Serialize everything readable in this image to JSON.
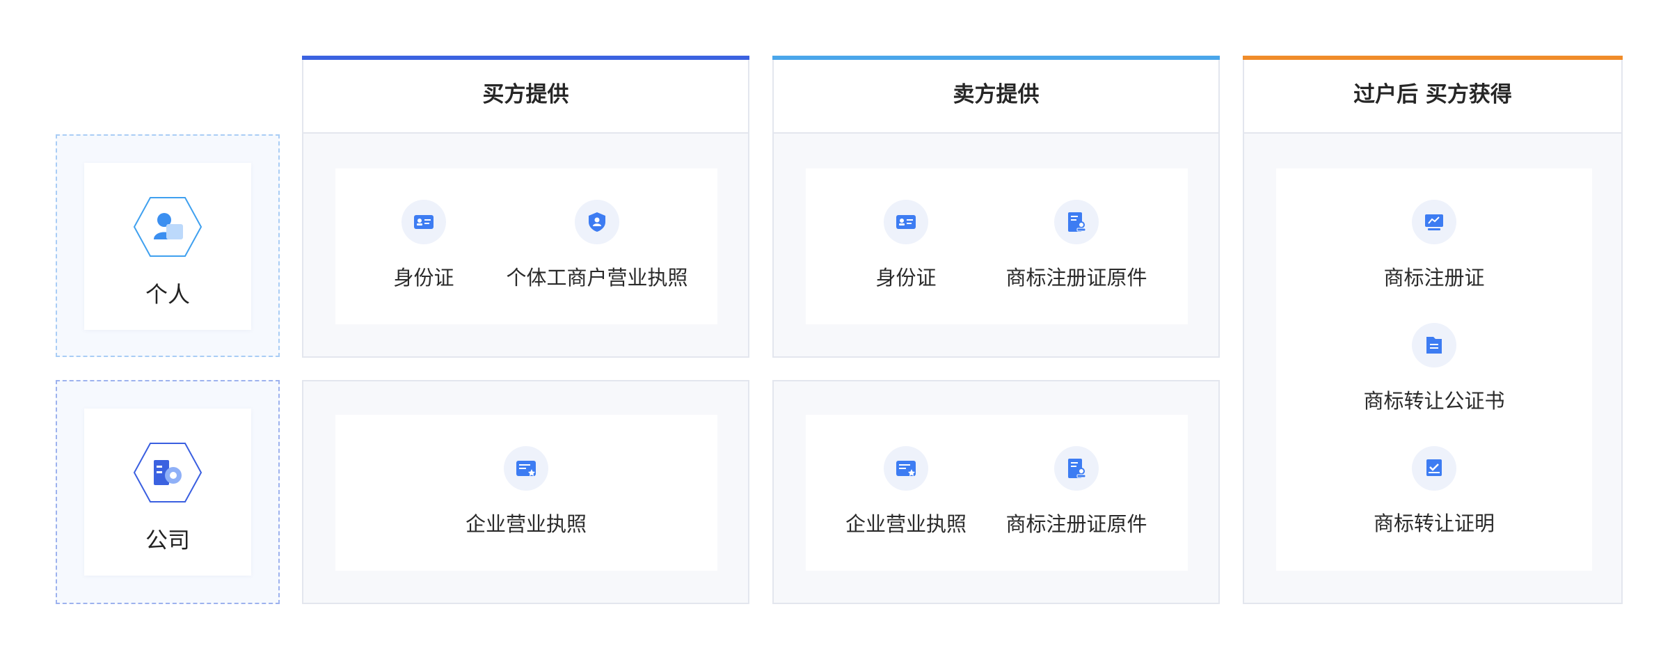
{
  "rows": [
    {
      "id": "personal",
      "label": "个人",
      "icon": "person-icon"
    },
    {
      "id": "company",
      "label": "公司",
      "icon": "company-icon"
    }
  ],
  "columns": [
    {
      "id": "buyer",
      "title": "买方提供",
      "accent": "#3b62e0"
    },
    {
      "id": "seller",
      "title": "卖方提供",
      "accent": "#4aa6ea"
    },
    {
      "id": "after",
      "title": "过户后 买方获得",
      "accent": "#f08c2a"
    }
  ],
  "cells": {
    "buyer_personal": [
      {
        "label": "身份证",
        "icon": "id-card-icon"
      },
      {
        "label": "个体工商户营业执照",
        "icon": "shield-badge-icon"
      }
    ],
    "seller_personal": [
      {
        "label": "身份证",
        "icon": "id-card-icon"
      },
      {
        "label": "商标注册证原件",
        "icon": "document-stamp-icon"
      }
    ],
    "buyer_company": [
      {
        "label": "企业营业执照",
        "icon": "license-star-icon"
      }
    ],
    "seller_company": [
      {
        "label": "企业营业执照",
        "icon": "license-star-icon"
      },
      {
        "label": "商标注册证原件",
        "icon": "document-stamp-icon"
      }
    ],
    "after": [
      {
        "label": "商标注册证",
        "icon": "certificate-chart-icon"
      },
      {
        "label": "商标转让公证书",
        "icon": "folder-doc-icon"
      },
      {
        "label": "商标转让证明",
        "icon": "checked-doc-icon"
      }
    ]
  },
  "colors": {
    "primary": "#3d7cf2",
    "icon_bg": "#eef2fb",
    "border": "#e3e6ee",
    "panel_bg": "#f7f8fb"
  }
}
